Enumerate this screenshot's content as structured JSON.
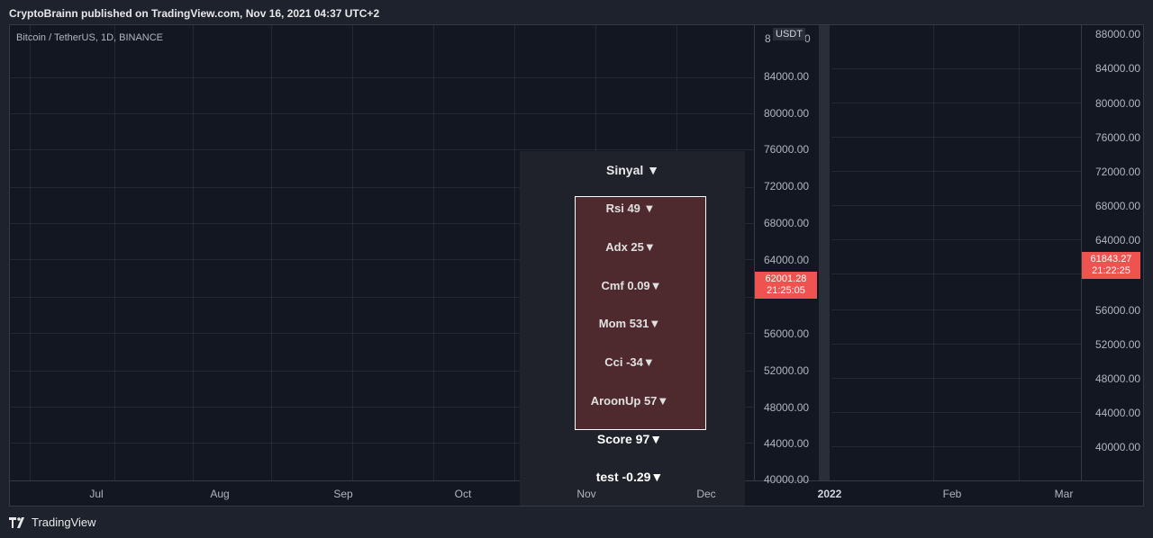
{
  "header": {
    "title": "CryptoBrainn published on TradingView.com, Nov 16, 2021 04:37 UTC+2"
  },
  "chart": {
    "symbol": "Bitcoin / TetherUS, 1D, BINANCE",
    "currency": "USDT",
    "left_axis": [
      "84000.00",
      "80000.00",
      "76000.00",
      "72000.00",
      "68000.00",
      "64000.00",
      "56000.00",
      "52000.00",
      "48000.00",
      "44000.00",
      "40000.00"
    ],
    "left_axis_top_partial": "8",
    "left_axis_top_partial_end": "0",
    "right_axis": [
      "88000.00",
      "84000.00",
      "80000.00",
      "76000.00",
      "72000.00",
      "68000.00",
      "64000.00",
      "56000.00",
      "52000.00",
      "48000.00",
      "44000.00",
      "40000.00"
    ],
    "left_price": {
      "value": "62001.28",
      "time": "21:25:05"
    },
    "right_price": {
      "value": "61843.27",
      "time": "21:22:25"
    },
    "time_axis": [
      "Jul",
      "Aug",
      "Sep",
      "Oct",
      "Nov",
      "Dec",
      "2022",
      "Feb",
      "Mar"
    ],
    "accent_color": "#ef5350"
  },
  "panel": {
    "title": "Sinyal ▼",
    "indicators": [
      {
        "label": "Rsi  49 ▼"
      },
      {
        "label": "Adx  25▼"
      },
      {
        "label": "Cmf 0.09▼"
      },
      {
        "label": "Mom  531▼"
      },
      {
        "label": "Cci    -34▼"
      },
      {
        "label": "AroonUp  57▼"
      }
    ],
    "score": "Score  97▼",
    "test": "test  -0.29▼"
  },
  "footer": {
    "brand": "TradingView"
  }
}
